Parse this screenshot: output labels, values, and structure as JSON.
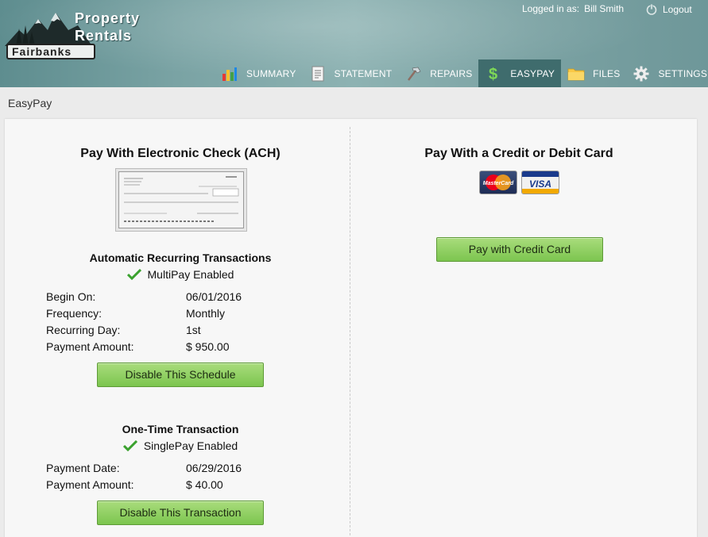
{
  "brand": {
    "line1": "Property",
    "line2": "Rentals",
    "badge": "Fairbanks"
  },
  "account": {
    "logged_in_label": "Logged in as:",
    "user_name": "Bill Smith",
    "logout_label": "Logout"
  },
  "nav": {
    "items": [
      {
        "label": "SUMMARY",
        "icon": "bar-chart-icon"
      },
      {
        "label": "STATEMENT",
        "icon": "document-icon"
      },
      {
        "label": "REPAIRS",
        "icon": "hammer-icon"
      },
      {
        "label": "EASYPAY",
        "icon": "dollar-icon",
        "active": true
      },
      {
        "label": "FILES",
        "icon": "folder-icon"
      },
      {
        "label": "SETTINGS",
        "icon": "gear-icon"
      }
    ]
  },
  "page": {
    "title": "EasyPay"
  },
  "ach": {
    "heading": "Pay With Electronic Check (ACH)",
    "recurring": {
      "heading": "Automatic Recurring Transactions",
      "status": "MultiPay Enabled",
      "begin_label": "Begin On:",
      "begin_value": "06/01/2016",
      "frequency_label": "Frequency:",
      "frequency_value": "Monthly",
      "day_label": "Recurring Day:",
      "day_value": "1st",
      "amount_label": "Payment Amount:",
      "amount_value": "$ 950.00",
      "button": "Disable This Schedule"
    },
    "one_time": {
      "heading": "One-Time Transaction",
      "status": "SinglePay Enabled",
      "date_label": "Payment Date:",
      "date_value": "06/29/2016",
      "amount_label": "Payment Amount:",
      "amount_value": "$ 40.00",
      "button": "Disable This Transaction"
    }
  },
  "card": {
    "heading": "Pay With a Credit or Debit Card",
    "mastercard_label": "MasterCard",
    "visa_label": "VISA",
    "button": "Pay with Credit Card"
  },
  "colors": {
    "header": "#7aa3a4",
    "nav_active": "#3f6c6d",
    "button_green": "#8fd05e",
    "check_green": "#3aa12e"
  }
}
